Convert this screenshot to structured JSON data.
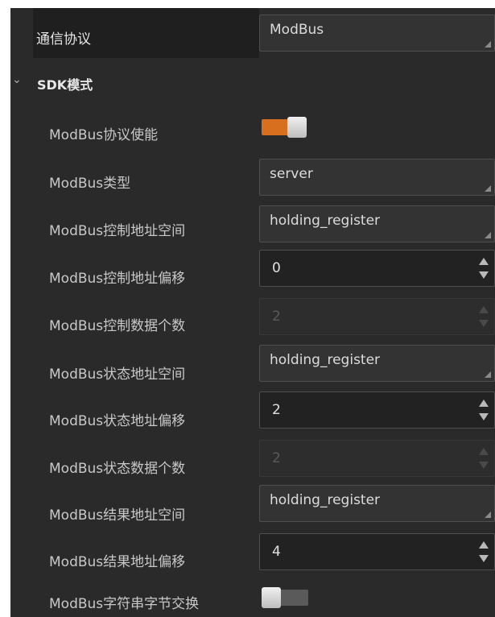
{
  "protocol": {
    "label": "通信协议",
    "value": "ModBus"
  },
  "section": {
    "title": "SDK模式",
    "expanded": true
  },
  "rows": [
    {
      "label": "ModBus协议使能",
      "kind": "toggle",
      "state": "on"
    },
    {
      "label": "ModBus类型",
      "kind": "select",
      "value": "server"
    },
    {
      "label": "ModBus控制地址空间",
      "kind": "select",
      "value": "holding_register"
    },
    {
      "label": "ModBus控制地址偏移",
      "kind": "spin",
      "value": "0",
      "enabled": true
    },
    {
      "label": "ModBus控制数据个数",
      "kind": "spin",
      "value": "2",
      "enabled": false
    },
    {
      "label": "ModBus状态地址空间",
      "kind": "select",
      "value": "holding_register"
    },
    {
      "label": "ModBus状态地址偏移",
      "kind": "spin",
      "value": "2",
      "enabled": true
    },
    {
      "label": "ModBus状态数据个数",
      "kind": "spin",
      "value": "2",
      "enabled": false
    },
    {
      "label": "ModBus结果地址空间",
      "kind": "select",
      "value": "holding_register"
    },
    {
      "label": "ModBus结果地址偏移",
      "kind": "spin",
      "value": "4",
      "enabled": true
    },
    {
      "label": "ModBus字符串字节交换",
      "kind": "toggle",
      "state": "off"
    }
  ],
  "colors": {
    "toggle_on": "#d86f1f",
    "panel_bg": "#2a2a2a"
  }
}
